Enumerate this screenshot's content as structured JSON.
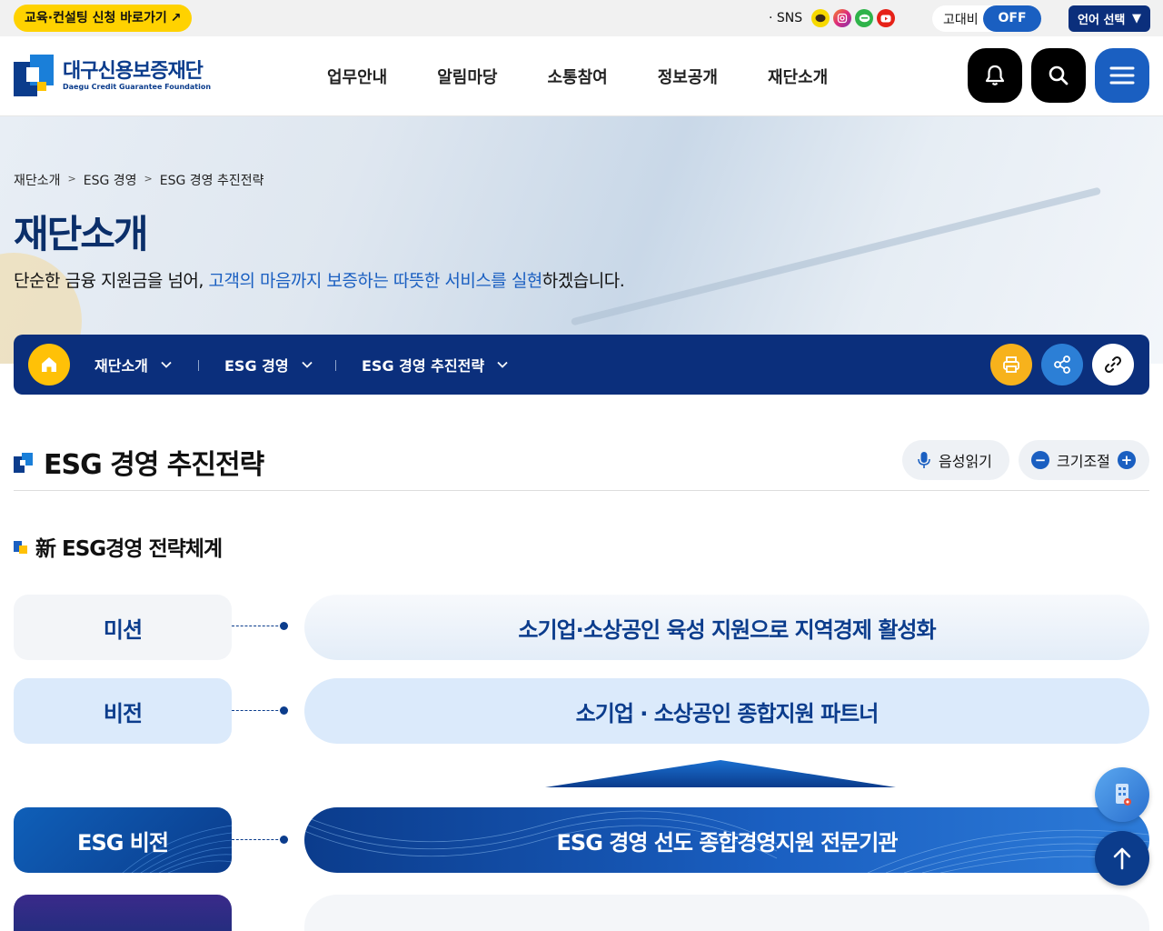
{
  "topbar": {
    "apply_label": "교육·컨설팅 신청 바로가기",
    "apply_arrow": "↗",
    "sns_label": "· SNS",
    "sns_icons": [
      "kakaotalk-icon",
      "instagram-icon",
      "line-icon",
      "youtube-icon"
    ],
    "contrast_label": "고대비",
    "contrast_state": "OFF",
    "language_label": "언어 선택",
    "language_caret": "▼"
  },
  "header": {
    "logo_ko": "대구신용보증재단",
    "logo_en": "Daegu Credit Guarantee Foundation",
    "nav": [
      "업무안내",
      "알림마당",
      "소통참여",
      "정보공개",
      "재단소개"
    ]
  },
  "visual": {
    "breadcrumb": [
      "재단소개",
      "ESG 경영",
      "ESG 경영 추진전략"
    ],
    "breadcrumb_sep": ">",
    "title": "재단소개",
    "desc_pre": "단순한 금융 지원금을 넘어, ",
    "desc_highlight": "고객의 마음까지 보증하는 따뜻한 서비스를 실현",
    "desc_post": "하겠습니다."
  },
  "location": {
    "items": [
      "재단소개",
      "ESG 경영",
      "ESG 경영 추진전략"
    ],
    "divider": "|"
  },
  "content": {
    "title": "ESG 경영 추진전략",
    "voice_label": "음성읽기",
    "size_label": "크기조절",
    "minus": "−",
    "plus": "+"
  },
  "section": {
    "title": "新 ESG경영 전략체계"
  },
  "strategy": {
    "mission_label": "미션",
    "mission_text": "소기업·소상공인 육성 지원으로 지역경제 활성화",
    "vision_label": "비전",
    "vision_text": "소기업 · 소상공인 종합지원 파트너",
    "esg_label": "ESG 비전",
    "esg_text": "ESG 경영 선도 종합경영지원 전문기관"
  },
  "colors": {
    "navy": "#0b2f7c",
    "brand_blue": "#1a5fc1",
    "yellow": "#ffc107",
    "apply_yellow": "#ffd200"
  }
}
